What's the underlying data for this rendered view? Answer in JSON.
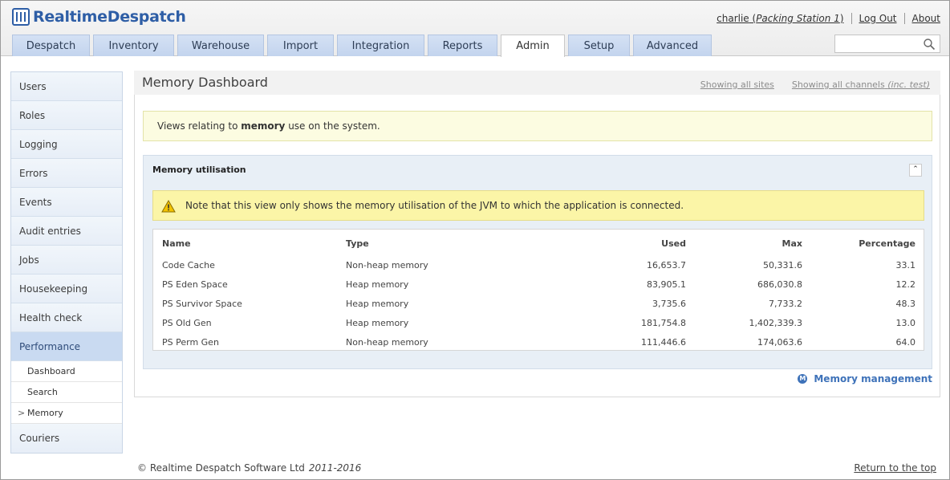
{
  "brand": {
    "name_bold": "Realtime",
    "name_rest": "Despatch"
  },
  "user": {
    "name": "charlie",
    "station": "Packing Station 1",
    "logout": "Log Out",
    "about": "About"
  },
  "tabs": [
    "Despatch",
    "Inventory",
    "Warehouse",
    "Import",
    "Integration",
    "Reports",
    "Admin",
    "Setup",
    "Advanced"
  ],
  "active_tab": "Admin",
  "search": {
    "placeholder": ""
  },
  "sidebar": {
    "items_top": [
      "Users",
      "Roles",
      "Logging",
      "Errors",
      "Events",
      "Audit entries",
      "Jobs",
      "Housekeeping",
      "Health check"
    ],
    "active": "Performance",
    "subitems": [
      "Dashboard",
      "Search",
      "Memory"
    ],
    "current_sub": "Memory",
    "items_bottom": [
      "Couriers"
    ]
  },
  "page": {
    "title": "Memory Dashboard",
    "sites_link": "Showing all sites",
    "channels_link": "Showing all channels",
    "channels_note": "(inc. test)"
  },
  "info": {
    "prefix": "Views relating to",
    "keyword": "memory",
    "suffix": "use on the system."
  },
  "section": {
    "title": "Memory utilisation",
    "collapse_glyph": "⌃",
    "warning": "Note that this view only shows the memory utilisation of the JVM to which the application is connected.",
    "columns": {
      "name": "Name",
      "type": "Type",
      "used": "Used",
      "max": "Max",
      "pct": "Percentage"
    },
    "rows": [
      {
        "name": "Code Cache",
        "type": "Non-heap memory",
        "used": "16,653.7",
        "max": "50,331.6",
        "pct": "33.1"
      },
      {
        "name": "PS Eden Space",
        "type": "Heap memory",
        "used": "83,905.1",
        "max": "686,030.8",
        "pct": "12.2"
      },
      {
        "name": "PS Survivor Space",
        "type": "Heap memory",
        "used": "3,735.6",
        "max": "7,733.2",
        "pct": "48.3"
      },
      {
        "name": "PS Old Gen",
        "type": "Heap memory",
        "used": "181,754.8",
        "max": "1,402,339.3",
        "pct": "13.0"
      },
      {
        "name": "PS Perm Gen",
        "type": "Non-heap memory",
        "used": "111,446.6",
        "max": "174,063.6",
        "pct": "64.0"
      }
    ]
  },
  "memory_link": {
    "icon": "M",
    "label": "Memory management"
  },
  "footer": {
    "copyright": "© Realtime Despatch Software Ltd",
    "years": "2011-2016",
    "top_link": "Return to the top"
  },
  "colors": {
    "accent": "#3e72b9",
    "tab": "#c9d9f1",
    "warning": "#fbf5a7",
    "info": "#fcfce1"
  }
}
